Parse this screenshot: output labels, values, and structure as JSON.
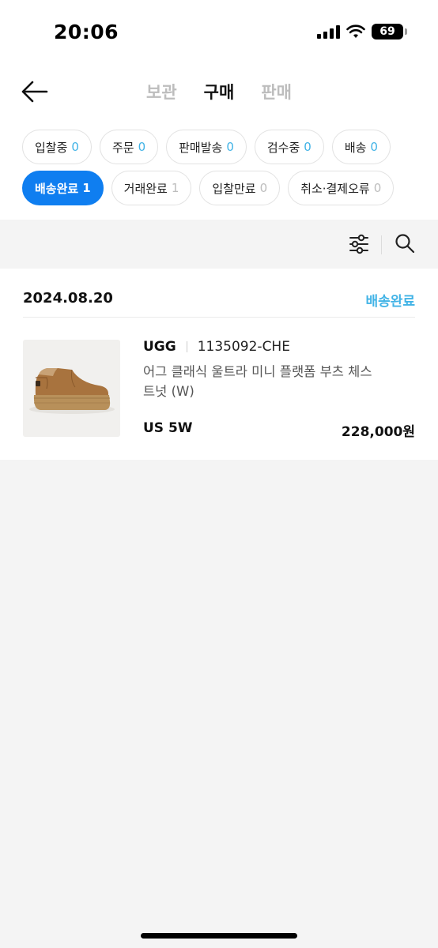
{
  "status_bar": {
    "time": "20:06",
    "battery": "69"
  },
  "header": {
    "tabs": [
      {
        "label": "보관",
        "active": false
      },
      {
        "label": "구매",
        "active": true
      },
      {
        "label": "판매",
        "active": false
      }
    ]
  },
  "chips": [
    {
      "label": "입찰중",
      "count": "0"
    },
    {
      "label": "주문",
      "count": "0"
    },
    {
      "label": "판매발송",
      "count": "0"
    },
    {
      "label": "검수중",
      "count": "0"
    },
    {
      "label": "배송",
      "count": "0"
    },
    {
      "label": "배송완료",
      "count": "1",
      "active": true
    },
    {
      "label": "거래완료",
      "count": "1"
    },
    {
      "label": "입찰만료",
      "count": "0"
    },
    {
      "label": "취소·결제오류",
      "count": "0"
    }
  ],
  "order": {
    "date": "2024.08.20",
    "status": "배송완료",
    "brand": "UGG",
    "sku": "1135092-CHE",
    "name": "어그 클래식 울트라 미니 플랫폼 부츠 체스트넛 (W)",
    "size": "US 5W",
    "price": "228,000원"
  },
  "colors": {
    "accent": "#0f7ef0",
    "status_blue": "#41b3e6"
  }
}
